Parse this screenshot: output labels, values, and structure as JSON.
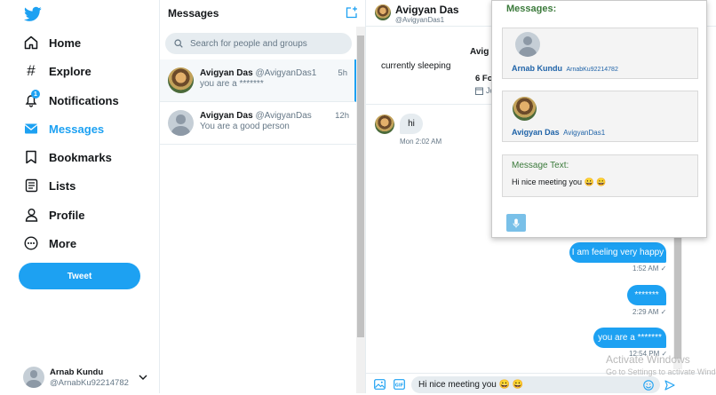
{
  "nav": {
    "items": [
      {
        "label": "Home",
        "icon": "home-icon"
      },
      {
        "label": "Explore",
        "icon": "hashtag-icon"
      },
      {
        "label": "Notifications",
        "icon": "bell-icon",
        "badge": "1"
      },
      {
        "label": "Messages",
        "icon": "envelope-icon",
        "active": true
      },
      {
        "label": "Bookmarks",
        "icon": "bookmark-icon"
      },
      {
        "label": "Lists",
        "icon": "list-icon"
      },
      {
        "label": "Profile",
        "icon": "person-icon"
      },
      {
        "label": "More",
        "icon": "more-icon"
      }
    ],
    "tweet_label": "Tweet",
    "account": {
      "name": "Arnab Kundu",
      "handle": "@ArnabKu92214782"
    }
  },
  "messages": {
    "title": "Messages",
    "search_placeholder": "Search for people and groups",
    "conversations": [
      {
        "name": "Avigyan Das",
        "handle": "@AvigyanDas1",
        "time": "5h",
        "preview": "you are a *******"
      },
      {
        "name": "Avigyan Das",
        "handle": "@AvigyanDas",
        "time": "12h",
        "preview": "You are a good person"
      }
    ]
  },
  "chat": {
    "header_name": "Avigyan Das",
    "header_handle": "@AvigyanDas1",
    "profile_name_partial": "Avig",
    "bio": "currently sleeping",
    "following_partial": "6 Fo",
    "joined_partial": "Jo",
    "incoming": {
      "text": "hi",
      "time": "Mon 2:02 AM"
    },
    "outgoing": [
      {
        "text": "I am feeling very happy",
        "time": "1:52 AM ✓"
      },
      {
        "text": "*******",
        "time": "2:29 AM ✓"
      },
      {
        "text": "you are a *******",
        "time": "12:54 PM ✓"
      }
    ],
    "composer_value": "Hi nice meeting you 😀 😀"
  },
  "popup": {
    "title": "Messages:",
    "from": {
      "name": "Arnab Kundu",
      "handle": "ArnabKu92214782"
    },
    "to": {
      "name": "Avigyan Das",
      "handle": "AvigyanDas1"
    },
    "message_label": "Message Text:",
    "message_text": "Hi nice meeting you 😀 😀"
  },
  "watermark": {
    "line1": "Activate Windows",
    "line2": "Go to Settings to activate Windows."
  },
  "colors": {
    "accent": "#1da1f2",
    "popup_green": "#3b7a3b",
    "popup_blue": "#1f63a8"
  }
}
